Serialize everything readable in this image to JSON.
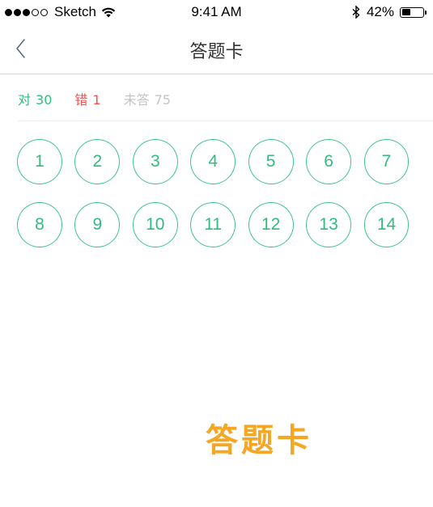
{
  "status_bar": {
    "carrier": "Sketch",
    "time": "9:41 AM",
    "battery_percent": "42%",
    "battery_level": 0.42,
    "signal_bars_filled": 3,
    "signal_bars_total": 5
  },
  "nav": {
    "title": "答题卡",
    "back_icon": "chevron-left-icon"
  },
  "summary": {
    "correct_label": "对",
    "correct_count": "30",
    "wrong_label": "错",
    "wrong_count": "1",
    "unanswered_label": "未答",
    "unanswered_count": "75"
  },
  "questions": {
    "row1": [
      "1",
      "2",
      "3",
      "4",
      "5",
      "6",
      "7"
    ],
    "row2": [
      "8",
      "9",
      "10",
      "11",
      "12",
      "13",
      "14"
    ]
  },
  "caption": "答题卡",
  "colors": {
    "correct": "#2fbf7f",
    "wrong": "#f0514f",
    "unanswered": "#c4c4c4",
    "circle_border": "#3cc48a",
    "caption": "#f5a623"
  }
}
